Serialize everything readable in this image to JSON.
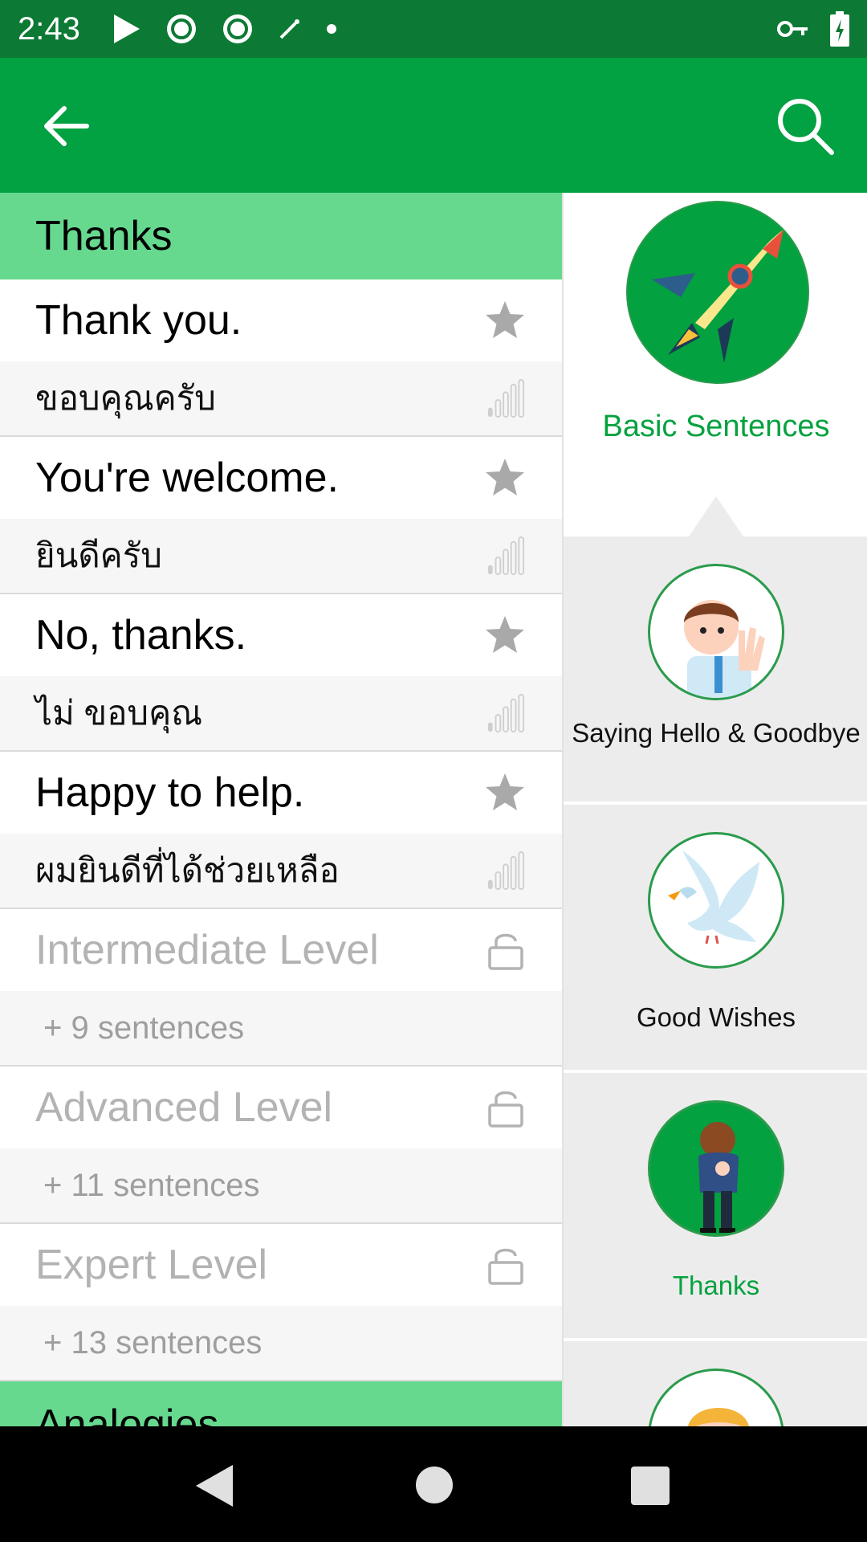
{
  "status_bar": {
    "time": "2:43",
    "icons_left": [
      "play-icon",
      "sync-icon",
      "sync-icon",
      "wand-icon",
      "dot-icon"
    ],
    "icons_right": [
      "key-icon",
      "battery-charging-icon"
    ]
  },
  "app_bar": {
    "background": "#02a141",
    "back_icon": "arrow-back-icon",
    "search_icon": "search-icon"
  },
  "phrases_panel": {
    "section_title": "Thanks",
    "phrases": [
      {
        "english": "Thank you.",
        "thai": "ขอบคุณครับ"
      },
      {
        "english": "You're welcome.",
        "thai": "ยินดีครับ"
      },
      {
        "english": "No, thanks.",
        "thai": "ไม่ ขอบคุณ"
      },
      {
        "english": "Happy to help.",
        "thai": "ผมยินดีที่ได้ช่วยเหลือ"
      }
    ],
    "locked_levels": [
      {
        "title": "Intermediate Level",
        "subtitle": "+ 9 sentences"
      },
      {
        "title": "Advanced Level",
        "subtitle": "+ 11 sentences"
      },
      {
        "title": "Expert Level",
        "subtitle": "+ 13 sentences"
      }
    ],
    "next_section_title": "Analogies"
  },
  "categories_panel": {
    "items": [
      {
        "label": "Basic Sentences",
        "icon": "rocket-icon",
        "state": "current"
      },
      {
        "label": "Saying Hello & Goodbye",
        "icon": "waving-man-icon",
        "state": "normal"
      },
      {
        "label": "Good Wishes",
        "icon": "dove-icon",
        "state": "normal"
      },
      {
        "label": "Thanks",
        "icon": "bowing-person-icon",
        "state": "selected"
      },
      {
        "label": "",
        "icon": "blonde-person-icon",
        "state": "normal"
      }
    ]
  },
  "colors": {
    "status_bar": "#0c7a34",
    "section_header": "#66d98f",
    "accent_green": "#05a23f",
    "locked_text": "#b3b3b3"
  },
  "nav_bar": {
    "icons": [
      "nav-back-icon",
      "nav-home-icon",
      "nav-recents-icon"
    ]
  }
}
